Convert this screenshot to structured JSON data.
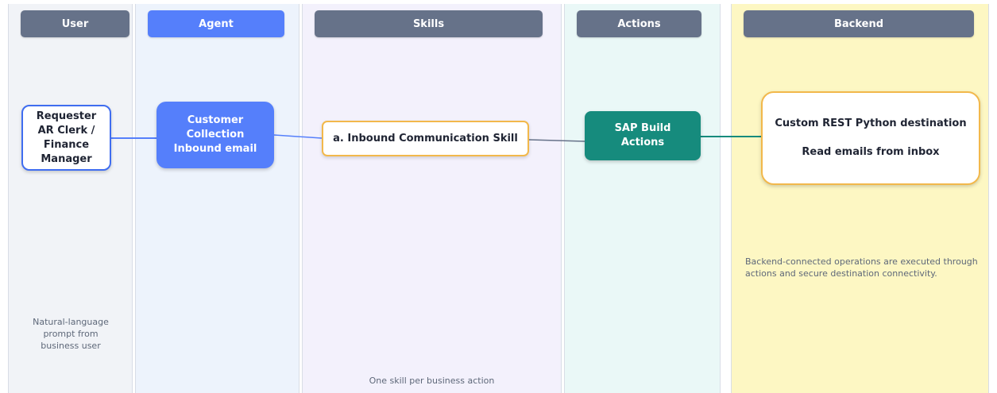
{
  "lanes": {
    "user": {
      "header": "User",
      "note": "Natural-language prompt from business user"
    },
    "agent": {
      "header": "Agent"
    },
    "skills": {
      "header": "Skills",
      "note": "One skill per business action"
    },
    "actions": {
      "header": "Actions"
    },
    "backend": {
      "header": "Backend",
      "note": "Backend-connected operations are executed through actions and secure destination connectivity."
    }
  },
  "nodes": {
    "requester": {
      "lines": [
        "Requester",
        "AR Clerk /",
        "Finance",
        "Manager"
      ]
    },
    "agent": {
      "lines": [
        "Customer",
        "Collection",
        "Inbound email"
      ]
    },
    "skill": {
      "label": "a. Inbound Communication Skill"
    },
    "actions": {
      "lines": [
        "SAP Build",
        "Actions"
      ]
    },
    "backend": {
      "line1": "Custom REST Python destination",
      "line2": "Read emails from inbox"
    }
  },
  "colors": {
    "agent_blue": "#557ffb",
    "header_slate": "#667289",
    "action_teal": "#168b7d",
    "highlight_orange": "#f2b84b",
    "backend_yellow": "#fdf7c3"
  }
}
